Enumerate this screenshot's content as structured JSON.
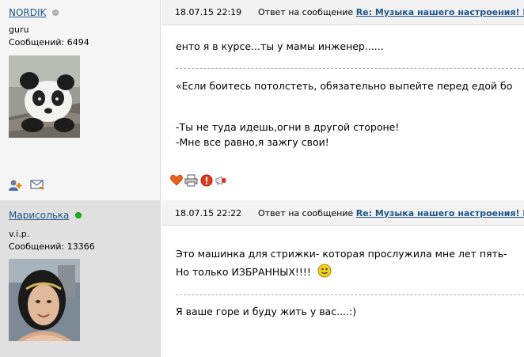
{
  "posts": [
    {
      "author": "NORDIK",
      "status": "offline",
      "rank": "guru",
      "messages_label": "Сообщений: 6494",
      "date": "18.07.15 22:19",
      "reply_prefix": "Ответ на сообщение",
      "reply_link": "Re: Музыка нашего настроения! М",
      "lines": [
        "енто я в курсе...ты у мамы инженер......",
        "«Если боитесь потолстеть, обязательно выпейте перед едой бо",
        "-Ты не туда идешь,огни в другой стороне!",
        "-Мне все равно,я зажгу свои!"
      ]
    },
    {
      "author": "Марисолька",
      "status": "online",
      "rank": "v.i.p.",
      "messages_label": "Сообщений: 13366",
      "date": "18.07.15 22:22",
      "reply_prefix": "Ответ на сообщение",
      "reply_link": "Re: Музыка нашего настроения! М",
      "lines": [
        "Это машинка для стрижки- которая прослужила мне лет пять-",
        "Но только ИЗБРАННЫХ!!!!",
        "Я ваше горе и буду жить у вас....:)"
      ]
    }
  ],
  "colors": {
    "link": "#1c5587",
    "online": "#18b418",
    "offline": "#b9b9b9"
  },
  "icons": [
    "add-friend-icon",
    "envelope-icon",
    "heart-icon",
    "printer-icon",
    "warning-icon",
    "megaphone-icon",
    "smiley-icon"
  ]
}
